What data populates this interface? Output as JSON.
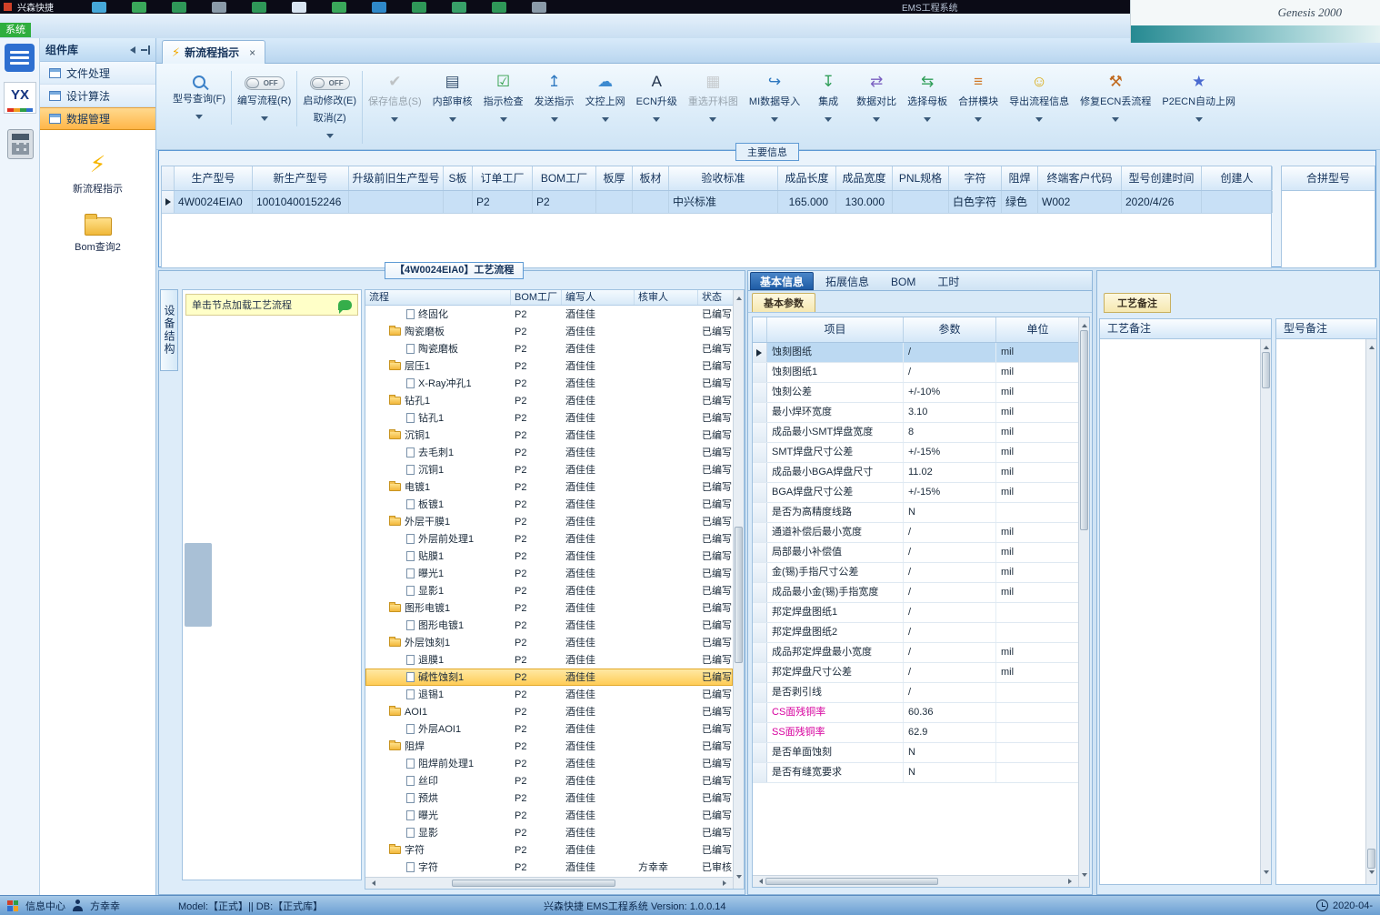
{
  "titlebar": {
    "app_name": "兴森快捷",
    "right_text": "EMS工程系统",
    "icons": [
      {
        "name": "search-icon",
        "color": "#46a8d8"
      },
      {
        "name": "refresh-icon",
        "color": "#3aa85a"
      },
      {
        "name": "table-icon",
        "color": "#2f9858"
      },
      {
        "name": "cut-icon",
        "color": "#8a9aa8"
      },
      {
        "name": "module-icon",
        "color": "#2f9858"
      },
      {
        "name": "document-icon",
        "color": "#d8e4f0"
      },
      {
        "name": "copy-icon",
        "color": "#3aa85a"
      },
      {
        "name": "grid-icon",
        "color": "#2f88c8"
      },
      {
        "name": "users-icon",
        "color": "#2f9858"
      },
      {
        "name": "image-icon",
        "color": "#38a068"
      },
      {
        "name": "package-icon",
        "color": "#2f9858"
      },
      {
        "name": "settings-icon",
        "color": "#8a9aa8"
      }
    ],
    "background_window": {
      "title": "Genesis 2000"
    }
  },
  "menubar": {
    "system_label": "系统"
  },
  "left_rail": {
    "logo": "YX"
  },
  "sidebar": {
    "header": "组件库",
    "groups": [
      {
        "label": "文件处理",
        "cls": "",
        "dn": "sidebar-item-file-processing"
      },
      {
        "label": "设计算法",
        "cls": "",
        "dn": "sidebar-item-design-algorithm"
      },
      {
        "label": "数据管理",
        "cls": "active",
        "dn": "sidebar-item-data-management"
      }
    ],
    "tools": [
      {
        "label": "新流程指示",
        "glyph": "⚡"
      },
      {
        "label": "Bom查询2"
      }
    ]
  },
  "tabbar": {
    "tab_label": "新流程指示",
    "close_glyph": "×",
    "bolt_glyph": "⚡"
  },
  "toolbar": {
    "search_btn": {
      "label": "型号查询(F)"
    },
    "write_toggle": {
      "state": "OFF",
      "label": "编写流程(R)"
    },
    "modify_toggle": {
      "state": "OFF",
      "label": "启动修改(E)",
      "cancel_label": "取消(Z)"
    },
    "buttons": [
      {
        "label": "保存信息(S)",
        "dn": "save-info-button",
        "icon": "save-check-icon",
        "glyph": "✔",
        "color": "#9aa4ac",
        "cls": "disabled",
        "arrow": "y"
      },
      {
        "label": "内部审核",
        "dn": "internal-audit-button",
        "icon": "printer-icon",
        "glyph": "▤",
        "color": "#35506e",
        "arrow": ""
      },
      {
        "label": "指示检查",
        "dn": "instruction-check-button",
        "icon": "check-box-icon",
        "glyph": "☑",
        "color": "#2e9e48",
        "arrow": "y"
      },
      {
        "label": "发送指示",
        "dn": "send-instruction-button",
        "icon": "send-up-icon",
        "glyph": "↥",
        "color": "#2e78c0",
        "arrow": ""
      },
      {
        "label": "文控上网",
        "dn": "doc-control-upload-button",
        "icon": "cloud-upload-icon",
        "glyph": "☁",
        "color": "#3d8ad0",
        "arrow": "y"
      },
      {
        "label": "ECN升级",
        "dn": "ecn-upgrade-button",
        "icon": "font-upgrade-icon",
        "glyph": "A",
        "color": "#23344e",
        "arrow": ""
      },
      {
        "label": "重选开料图",
        "dn": "reselect-cutting-diagram-button",
        "icon": "image-icon",
        "glyph": "▦",
        "color": "#a8b2ba",
        "cls": "disabled",
        "arrow": ""
      },
      {
        "label": "MI数据导入",
        "dn": "mi-data-import-button",
        "icon": "import-icon",
        "glyph": "↪",
        "color": "#2e78c0",
        "arrow": "y"
      },
      {
        "label": "集成",
        "dn": "integrate-button",
        "icon": "download-icon",
        "glyph": "↧",
        "color": "#2f9e58",
        "arrow": "y"
      },
      {
        "label": "数据对比",
        "dn": "data-compare-button",
        "icon": "compare-icon",
        "glyph": "⇄",
        "color": "#7a5fc0",
        "arrow": "y"
      },
      {
        "label": "选择母板",
        "dn": "select-motherboard-button",
        "icon": "shuffle-icon",
        "glyph": "⇆",
        "color": "#2f9e58",
        "arrow": "y"
      },
      {
        "label": "合拼模块",
        "dn": "merge-module-button",
        "icon": "list-icon",
        "glyph": "≡",
        "color": "#d07828",
        "arrow": ""
      },
      {
        "label": "导出流程信息",
        "dn": "export-process-info-button",
        "icon": "smiley-icon",
        "glyph": "☺",
        "color": "#d8a400",
        "arrow": "y"
      },
      {
        "label": "修复ECN丢流程",
        "dn": "repair-ecn-button",
        "icon": "wrench-icon",
        "glyph": "⚒",
        "color": "#c06a20",
        "arrow": ""
      },
      {
        "label": "P2ECN自动上网",
        "dn": "p2ecn-auto-upload-button",
        "icon": "star-icon",
        "glyph": "★",
        "color": "#4a6ad0",
        "arrow": "y"
      }
    ]
  },
  "main_info": {
    "group_title": "主要信息",
    "columns": [
      "生产型号",
      "新生产型号",
      "升级前旧生产型号",
      "S板",
      "订单工厂",
      "BOM工厂",
      "板厚",
      "板材",
      "验收标准",
      "成品长度",
      "成品宽度",
      "PNL规格",
      "字符",
      "阻焊",
      "终端客户代码",
      "型号创建时间",
      "创建人"
    ],
    "row": [
      "4W0024EIA0",
      "10010400152246",
      "",
      "",
      "P2",
      "P2",
      "",
      "",
      "中兴标准",
      "165.000",
      "130.000",
      "",
      "白色字符",
      "绿色",
      "W002",
      "2020/4/26",
      ""
    ],
    "merge_table_header": "合拼型号"
  },
  "process": {
    "panel_title": "【4W0024EIA0】工艺流程",
    "side_tab": "设备结构",
    "tooltip": "单击节点加载工艺流程",
    "columns": [
      "流程",
      "BOM工厂",
      "编写人",
      "核审人",
      "状态"
    ],
    "rows": [
      {
        "cls": "lv2",
        "icontype": "file",
        "iconname": "file-icon",
        "name": "终固化",
        "bom": "P2",
        "writer": "酒佳佳",
        "auditor": "",
        "status": "已编写"
      },
      {
        "cls": "lv1",
        "icontype": "folder",
        "iconname": "folder-icon",
        "name": "陶瓷磨板",
        "bom": "P2",
        "writer": "酒佳佳",
        "auditor": "",
        "status": "已编写"
      },
      {
        "cls": "lv2",
        "icontype": "file",
        "iconname": "file-icon",
        "name": "陶瓷磨板",
        "bom": "P2",
        "writer": "酒佳佳",
        "auditor": "",
        "status": "已编写"
      },
      {
        "cls": "lv1",
        "icontype": "folder",
        "iconname": "folder-icon",
        "name": "层压1",
        "bom": "P2",
        "writer": "酒佳佳",
        "auditor": "",
        "status": "已编写"
      },
      {
        "cls": "lv2",
        "icontype": "file",
        "iconname": "file-icon",
        "name": "X-Ray冲孔1",
        "bom": "P2",
        "writer": "酒佳佳",
        "auditor": "",
        "status": "已编写"
      },
      {
        "cls": "lv1",
        "icontype": "folder",
        "iconname": "folder-icon",
        "name": "钻孔1",
        "bom": "P2",
        "writer": "酒佳佳",
        "auditor": "",
        "status": "已编写"
      },
      {
        "cls": "lv2",
        "icontype": "file",
        "iconname": "file-icon",
        "name": "钻孔1",
        "bom": "P2",
        "writer": "酒佳佳",
        "auditor": "",
        "status": "已编写"
      },
      {
        "cls": "lv1",
        "icontype": "folder",
        "iconname": "folder-icon",
        "name": "沉铜1",
        "bom": "P2",
        "writer": "酒佳佳",
        "auditor": "",
        "status": "已编写"
      },
      {
        "cls": "lv2",
        "icontype": "file",
        "iconname": "file-icon",
        "name": "去毛刺1",
        "bom": "P2",
        "writer": "酒佳佳",
        "auditor": "",
        "status": "已编写"
      },
      {
        "cls": "lv2",
        "icontype": "file",
        "iconname": "file-icon",
        "name": "沉铜1",
        "bom": "P2",
        "writer": "酒佳佳",
        "auditor": "",
        "status": "已编写"
      },
      {
        "cls": "lv1",
        "icontype": "folder",
        "iconname": "folder-icon",
        "name": "电镀1",
        "bom": "P2",
        "writer": "酒佳佳",
        "auditor": "",
        "status": "已编写"
      },
      {
        "cls": "lv2",
        "icontype": "file",
        "iconname": "file-icon",
        "name": "板镀1",
        "bom": "P2",
        "writer": "酒佳佳",
        "auditor": "",
        "status": "已编写"
      },
      {
        "cls": "lv1",
        "icontype": "folder",
        "iconname": "folder-icon",
        "name": "外层干膜1",
        "bom": "P2",
        "writer": "酒佳佳",
        "auditor": "",
        "status": "已编写"
      },
      {
        "cls": "lv2",
        "icontype": "file",
        "iconname": "file-icon",
        "name": "外层前处理1",
        "bom": "P2",
        "writer": "酒佳佳",
        "auditor": "",
        "status": "已编写"
      },
      {
        "cls": "lv2",
        "icontype": "file",
        "iconname": "file-icon",
        "name": "贴膜1",
        "bom": "P2",
        "writer": "酒佳佳",
        "auditor": "",
        "status": "已编写"
      },
      {
        "cls": "lv2",
        "icontype": "file",
        "iconname": "file-icon",
        "name": "曝光1",
        "bom": "P2",
        "writer": "酒佳佳",
        "auditor": "",
        "status": "已编写"
      },
      {
        "cls": "lv2",
        "icontype": "file",
        "iconname": "file-icon",
        "name": "显影1",
        "bom": "P2",
        "writer": "酒佳佳",
        "auditor": "",
        "status": "已编写"
      },
      {
        "cls": "lv1",
        "icontype": "folder",
        "iconname": "folder-icon",
        "name": "图形电镀1",
        "bom": "P2",
        "writer": "酒佳佳",
        "auditor": "",
        "status": "已编写"
      },
      {
        "cls": "lv2",
        "icontype": "file",
        "iconname": "file-icon",
        "name": "图形电镀1",
        "bom": "P2",
        "writer": "酒佳佳",
        "auditor": "",
        "status": "已编写"
      },
      {
        "cls": "lv1",
        "icontype": "folder",
        "iconname": "folder-icon",
        "name": "外层蚀刻1",
        "bom": "P2",
        "writer": "酒佳佳",
        "auditor": "",
        "status": "已编写"
      },
      {
        "cls": "lv2",
        "icontype": "file",
        "iconname": "file-icon",
        "name": "退膜1",
        "bom": "P2",
        "writer": "酒佳佳",
        "auditor": "",
        "status": "已编写"
      },
      {
        "cls": "lv2 sel",
        "icontype": "file",
        "iconname": "file-icon",
        "name": "碱性蚀刻1",
        "bom": "P2",
        "writer": "酒佳佳",
        "auditor": "",
        "status": "已编写"
      },
      {
        "cls": "lv2",
        "icontype": "file",
        "iconname": "file-icon",
        "name": "退锡1",
        "bom": "P2",
        "writer": "酒佳佳",
        "auditor": "",
        "status": "已编写"
      },
      {
        "cls": "lv1",
        "icontype": "folder",
        "iconname": "folder-icon",
        "name": "AOI1",
        "bom": "P2",
        "writer": "酒佳佳",
        "auditor": "",
        "status": "已编写"
      },
      {
        "cls": "lv2",
        "icontype": "file",
        "iconname": "file-icon",
        "name": "外层AOI1",
        "bom": "P2",
        "writer": "酒佳佳",
        "auditor": "",
        "status": "已编写"
      },
      {
        "cls": "lv1",
        "icontype": "folder",
        "iconname": "folder-icon",
        "name": "阻焊",
        "bom": "P2",
        "writer": "酒佳佳",
        "auditor": "",
        "status": "已编写"
      },
      {
        "cls": "lv2",
        "icontype": "file",
        "iconname": "file-icon",
        "name": "阻焊前处理1",
        "bom": "P2",
        "writer": "酒佳佳",
        "auditor": "",
        "status": "已编写"
      },
      {
        "cls": "lv2",
        "icontype": "file",
        "iconname": "file-icon",
        "name": "丝印",
        "bom": "P2",
        "writer": "酒佳佳",
        "auditor": "",
        "status": "已编写"
      },
      {
        "cls": "lv2",
        "icontype": "file",
        "iconname": "file-icon",
        "name": "预烘",
        "bom": "P2",
        "writer": "酒佳佳",
        "auditor": "",
        "status": "已编写"
      },
      {
        "cls": "lv2",
        "icontype": "file",
        "iconname": "file-icon",
        "name": "曝光",
        "bom": "P2",
        "writer": "酒佳佳",
        "auditor": "",
        "status": "已编写"
      },
      {
        "cls": "lv2",
        "icontype": "file",
        "iconname": "file-icon",
        "name": "显影",
        "bom": "P2",
        "writer": "酒佳佳",
        "auditor": "",
        "status": "已编写"
      },
      {
        "cls": "lv1",
        "icontype": "folder",
        "iconname": "folder-icon",
        "name": "字符",
        "bom": "P2",
        "writer": "酒佳佳",
        "auditor": "",
        "status": "已编写"
      },
      {
        "cls": "lv2",
        "icontype": "file",
        "iconname": "file-icon",
        "name": "字符",
        "bom": "P2",
        "writer": "酒佳佳",
        "auditor": "方幸幸",
        "status": "已审核"
      }
    ]
  },
  "params": {
    "tabs": [
      {
        "label": "基本信息",
        "cls": "active",
        "dn": "tab-basic-info"
      },
      {
        "label": "拓展信息",
        "cls": "",
        "dn": "tab-extended-info"
      },
      {
        "label": "BOM",
        "cls": "",
        "dn": "tab-bom"
      },
      {
        "label": "工时",
        "cls": "",
        "dn": "tab-work-hours"
      }
    ],
    "sub_tab": "基本参数",
    "columns": [
      "项目",
      "参数",
      "单位"
    ],
    "rows": [
      {
        "name": "蚀刻图纸",
        "value": "/",
        "unit": "mil",
        "cls": "sel"
      },
      {
        "name": "蚀刻图纸1",
        "value": "/",
        "unit": "mil"
      },
      {
        "name": "蚀刻公差",
        "value": "+/-10%",
        "unit": "mil"
      },
      {
        "name": "最小焊环宽度",
        "value": "3.10",
        "unit": "mil"
      },
      {
        "name": "成品最小SMT焊盘宽度",
        "value": "8",
        "unit": "mil"
      },
      {
        "name": "SMT焊盘尺寸公差",
        "value": "+/-15%",
        "unit": "mil"
      },
      {
        "name": "成品最小BGA焊盘尺寸",
        "value": "11.02",
        "unit": "mil"
      },
      {
        "name": "BGA焊盘尺寸公差",
        "value": "+/-15%",
        "unit": "mil"
      },
      {
        "name": "是否为高精度线路",
        "value": "N",
        "unit": ""
      },
      {
        "name": "通道补偿后最小宽度",
        "value": "/",
        "unit": "mil"
      },
      {
        "name": "局部最小补偿值",
        "value": "/",
        "unit": "mil"
      },
      {
        "name": "金(锡)手指尺寸公差",
        "value": "/",
        "unit": "mil"
      },
      {
        "name": "成品最小金(锡)手指宽度",
        "value": "/",
        "unit": "mil"
      },
      {
        "name": "邦定焊盘图纸1",
        "value": "/",
        "unit": ""
      },
      {
        "name": "邦定焊盘图纸2",
        "value": "/",
        "unit": ""
      },
      {
        "name": "成品邦定焊盘最小宽度",
        "value": "/",
        "unit": "mil"
      },
      {
        "name": "邦定焊盘尺寸公差",
        "value": "/",
        "unit": "mil"
      },
      {
        "name": "是否剥引线",
        "value": "/",
        "unit": ""
      },
      {
        "name": "CS面残铜率",
        "value": "60.36",
        "unit": "",
        "cls": "accent"
      },
      {
        "name": "SS面残铜率",
        "value": "62.9",
        "unit": "",
        "cls": "accent"
      },
      {
        "name": "是否单面蚀刻",
        "value": "N",
        "unit": ""
      },
      {
        "name": "是否有缝宽要求",
        "value": "N",
        "unit": ""
      }
    ]
  },
  "notes": {
    "tab": "工艺备注",
    "col1": "工艺备注",
    "col2": "型号备注"
  },
  "statusbar": {
    "info_center": "信息中心",
    "user": "方幸幸",
    "model_db": "Model:【正式】|| DB:【正式库】",
    "app_version": "兴森快捷 EMS工程系统 Version: 1.0.0.14",
    "date": "2020-04-"
  },
  "colors": {
    "highlight_row": "#ffcb52",
    "selected_row": "#c8e0f6",
    "accent_text": "#d6009e",
    "active_sidebar_item": "#ffb648",
    "status_green": "#2fae3e"
  }
}
